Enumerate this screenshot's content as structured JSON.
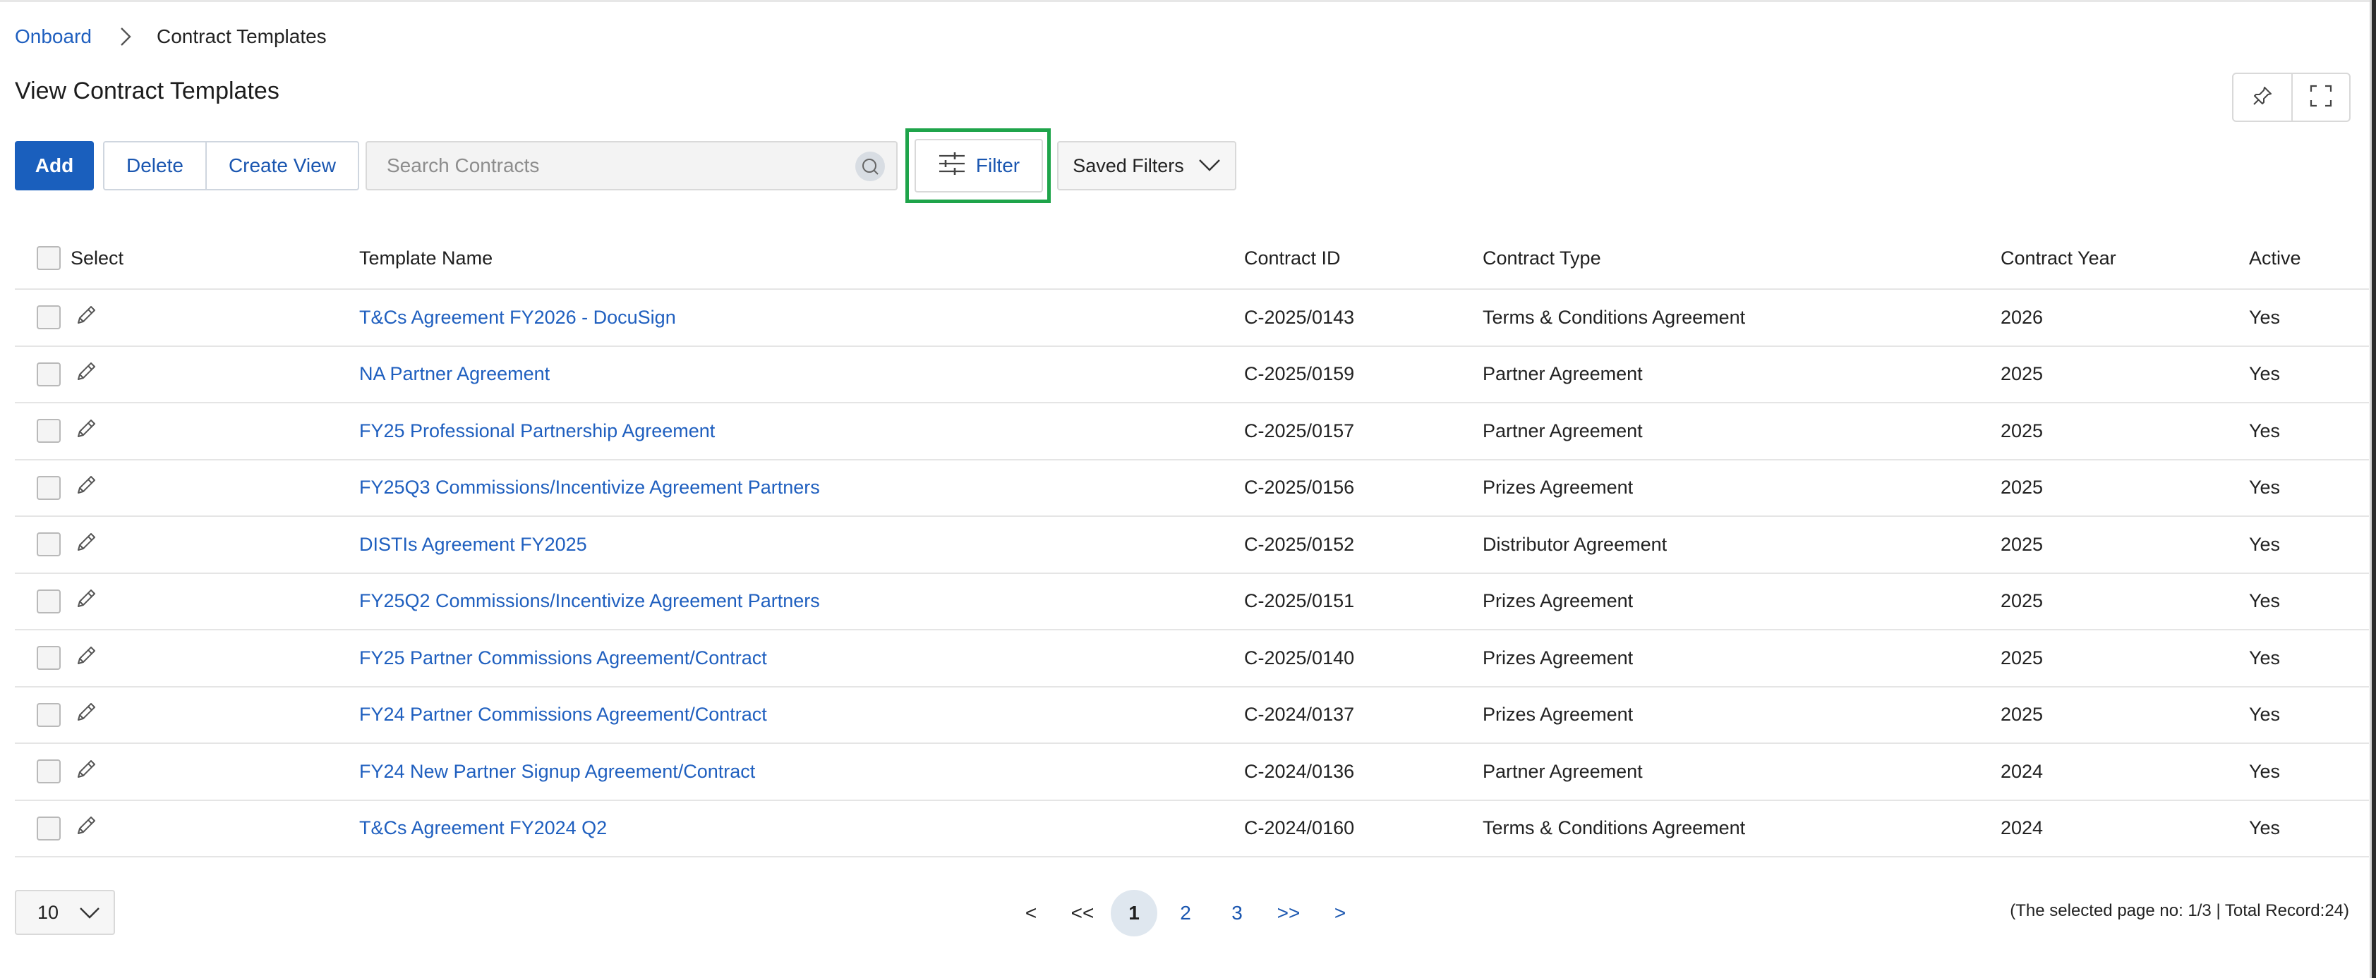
{
  "breadcrumb": {
    "root": "Onboard",
    "current": "Contract Templates"
  },
  "page_title": "View Contract Templates",
  "toolbar": {
    "add_label": "Add",
    "delete_label": "Delete",
    "create_view_label": "Create View",
    "search_placeholder": "Search Contracts",
    "filter_label": "Filter",
    "saved_filters_label": "Saved Filters"
  },
  "icons": {
    "breadcrumb_separator": "chevron-right-icon",
    "pin": "pin-icon",
    "fullscreen": "fullscreen-icon",
    "search": "search-icon",
    "filter": "sliders-icon",
    "saved_filters": "chevron-down-icon",
    "row_edit": "pencil-icon",
    "page_size": "chevron-down-icon"
  },
  "colors": {
    "primary": "#1a5fbd",
    "link": "#1f5fbf",
    "highlight": "#1ea44a"
  },
  "table": {
    "columns": {
      "select": "Select",
      "name": "Template Name",
      "id": "Contract ID",
      "type": "Contract Type",
      "year": "Contract Year",
      "active": "Active"
    },
    "rows": [
      {
        "name": "T&Cs Agreement FY2026 - DocuSign",
        "id": "C-2025/0143",
        "type": "Terms & Conditions Agreement",
        "year": "2026",
        "active": "Yes"
      },
      {
        "name": "NA Partner Agreement",
        "id": "C-2025/0159",
        "type": "Partner Agreement",
        "year": "2025",
        "active": "Yes"
      },
      {
        "name": "FY25 Professional Partnership Agreement",
        "id": "C-2025/0157",
        "type": "Partner Agreement",
        "year": "2025",
        "active": "Yes"
      },
      {
        "name": "FY25Q3 Commissions/Incentivize Agreement Partners",
        "id": "C-2025/0156",
        "type": "Prizes Agreement",
        "year": "2025",
        "active": "Yes"
      },
      {
        "name": "DISTIs Agreement FY2025",
        "id": "C-2025/0152",
        "type": "Distributor Agreement",
        "year": "2025",
        "active": "Yes"
      },
      {
        "name": "FY25Q2 Commissions/Incentivize Agreement Partners",
        "id": "C-2025/0151",
        "type": "Prizes Agreement",
        "year": "2025",
        "active": "Yes"
      },
      {
        "name": "FY25 Partner Commissions Agreement/Contract",
        "id": "C-2025/0140",
        "type": "Prizes Agreement",
        "year": "2025",
        "active": "Yes"
      },
      {
        "name": "FY24 Partner Commissions Agreement/Contract",
        "id": "C-2024/0137",
        "type": "Prizes Agreement",
        "year": "2025",
        "active": "Yes"
      },
      {
        "name": "FY24 New Partner Signup Agreement/Contract",
        "id": "C-2024/0136",
        "type": "Partner Agreement",
        "year": "2024",
        "active": "Yes"
      },
      {
        "name": "T&Cs Agreement FY2024 Q2",
        "id": "C-2024/0160",
        "type": "Terms & Conditions Agreement",
        "year": "2024",
        "active": "Yes"
      }
    ]
  },
  "pagination": {
    "page_size": "10",
    "prev": "<",
    "first": "<<",
    "pages": [
      "1",
      "2",
      "3"
    ],
    "current_page": "1",
    "last": ">>",
    "next": ">",
    "info": "(The selected page no: 1/3 | Total Record:24)"
  }
}
